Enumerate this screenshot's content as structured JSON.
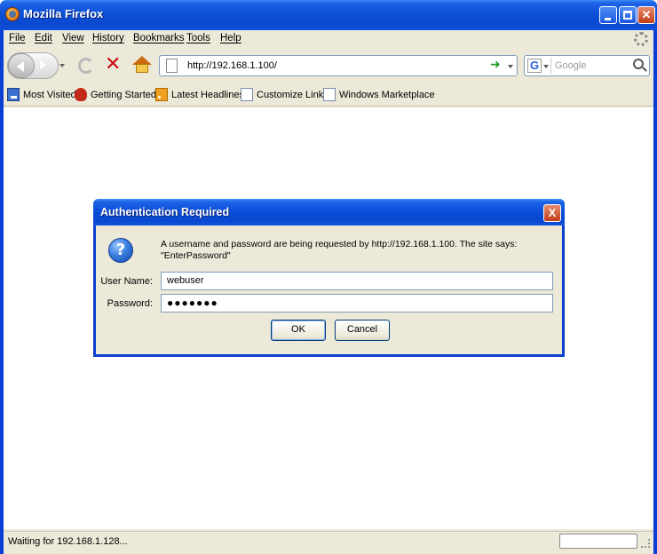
{
  "window": {
    "title": "Mozilla Firefox"
  },
  "menu": [
    "File",
    "Edit",
    "View",
    "History",
    "Bookmarks",
    "Tools",
    "Help"
  ],
  "nav": {
    "url": "http://192.168.1.100/",
    "search_placeholder": "Google",
    "search_engine_letter": "G"
  },
  "bookmarks": [
    "Most Visited",
    "Getting Started",
    "Latest Headlines",
    "Customize Links",
    "Windows Marketplace"
  ],
  "dialog": {
    "title": "Authentication Required",
    "message": "A username and password are being requested by http://192.168.1.100. The site says: \"EnterPassword\"",
    "username_label": "User Name:",
    "username_value": "webuser",
    "password_label": "Password:",
    "password_value": "●●●●●●●",
    "ok_label": "OK",
    "cancel_label": "Cancel",
    "close_glyph": "X",
    "icon_glyph": "?"
  },
  "status": {
    "text": "Waiting for 192.168.1.128..."
  },
  "colors": {
    "titlebar": "#0a48cf",
    "chrome": "#ece9d8",
    "close_button": "#c13d15"
  }
}
